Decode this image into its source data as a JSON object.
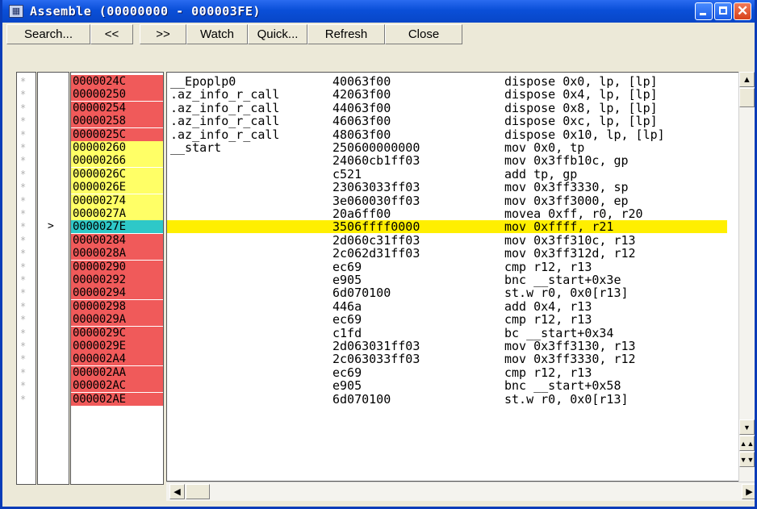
{
  "window": {
    "title": "Assemble (00000000 - 000003FE)"
  },
  "toolbar": [
    {
      "name": "search-button",
      "label": "Search..."
    },
    {
      "name": "prev-button",
      "label": "<<"
    },
    {
      "name": "next-button",
      "label": ">>"
    },
    {
      "name": "watch-button",
      "label": "Watch"
    },
    {
      "name": "quick-button",
      "label": "Quick..."
    },
    {
      "name": "refresh-button",
      "label": "Refresh"
    },
    {
      "name": "close-button",
      "label": "Close"
    }
  ],
  "colors": {
    "red": "#f05a5a",
    "yellow": "#ffff66",
    "cyan": "#2ec8c8",
    "highlight": "#ffef00"
  },
  "rows": [
    {
      "mark": "*",
      "ptr": "",
      "addr": "0000024C",
      "color": "red",
      "label": "__Epoplp0",
      "hex": "40063f00",
      "dis": "dispose 0x0, lp, [lp]",
      "hl": false
    },
    {
      "mark": "*",
      "ptr": "",
      "addr": "00000250",
      "color": "red",
      "label": ".az_info_r_call",
      "hex": "42063f00",
      "dis": "dispose 0x4, lp, [lp]",
      "hl": false
    },
    {
      "mark": "*",
      "ptr": "",
      "addr": "00000254",
      "color": "red",
      "label": ".az_info_r_call",
      "hex": "44063f00",
      "dis": "dispose 0x8, lp, [lp]",
      "hl": false
    },
    {
      "mark": "*",
      "ptr": "",
      "addr": "00000258",
      "color": "red",
      "label": ".az_info_r_call",
      "hex": "46063f00",
      "dis": "dispose 0xc, lp, [lp]",
      "hl": false
    },
    {
      "mark": "*",
      "ptr": "",
      "addr": "0000025C",
      "color": "red",
      "label": ".az_info_r_call",
      "hex": "48063f00",
      "dis": "dispose 0x10, lp, [lp]",
      "hl": false
    },
    {
      "mark": "*",
      "ptr": "",
      "addr": "00000260",
      "color": "yellow",
      "label": "__start",
      "hex": "250600000000",
      "dis": "mov 0x0, tp",
      "hl": false
    },
    {
      "mark": "*",
      "ptr": "",
      "addr": "00000266",
      "color": "yellow",
      "label": "",
      "hex": "24060cb1ff03",
      "dis": "mov 0x3ffb10c, gp",
      "hl": false
    },
    {
      "mark": "*",
      "ptr": "",
      "addr": "0000026C",
      "color": "yellow",
      "label": "",
      "hex": "c521",
      "dis": "add tp, gp",
      "hl": false
    },
    {
      "mark": "*",
      "ptr": "",
      "addr": "0000026E",
      "color": "yellow",
      "label": "",
      "hex": "23063033ff03",
      "dis": "mov 0x3ff3330, sp",
      "hl": false
    },
    {
      "mark": "*",
      "ptr": "",
      "addr": "00000274",
      "color": "yellow",
      "label": "",
      "hex": "3e060030ff03",
      "dis": "mov 0x3ff3000, ep",
      "hl": false
    },
    {
      "mark": "*",
      "ptr": "",
      "addr": "0000027A",
      "color": "yellow",
      "label": "",
      "hex": "20a6ff00",
      "dis": "movea 0xff, r0, r20",
      "hl": false
    },
    {
      "mark": "*",
      "ptr": ">",
      "addr": "0000027E",
      "color": "cyan",
      "label": "",
      "hex": "3506ffff0000",
      "dis": "mov 0xffff, r21",
      "hl": true
    },
    {
      "mark": "*",
      "ptr": "",
      "addr": "00000284",
      "color": "red",
      "label": "",
      "hex": "2d060c31ff03",
      "dis": "mov 0x3ff310c, r13",
      "hl": false
    },
    {
      "mark": "*",
      "ptr": "",
      "addr": "0000028A",
      "color": "red",
      "label": "",
      "hex": "2c062d31ff03",
      "dis": "mov 0x3ff312d, r12",
      "hl": false
    },
    {
      "mark": "*",
      "ptr": "",
      "addr": "00000290",
      "color": "red",
      "label": "",
      "hex": "ec69",
      "dis": "cmp r12, r13",
      "hl": false
    },
    {
      "mark": "*",
      "ptr": "",
      "addr": "00000292",
      "color": "red",
      "label": "",
      "hex": "e905",
      "dis": "bnc __start+0x3e",
      "hl": false
    },
    {
      "mark": "*",
      "ptr": "",
      "addr": "00000294",
      "color": "red",
      "label": "",
      "hex": "6d070100",
      "dis": "st.w r0, 0x0[r13]",
      "hl": false
    },
    {
      "mark": "*",
      "ptr": "",
      "addr": "00000298",
      "color": "red",
      "label": "",
      "hex": "446a",
      "dis": "add 0x4, r13",
      "hl": false
    },
    {
      "mark": "*",
      "ptr": "",
      "addr": "0000029A",
      "color": "red",
      "label": "",
      "hex": "ec69",
      "dis": "cmp r12, r13",
      "hl": false
    },
    {
      "mark": "*",
      "ptr": "",
      "addr": "0000029C",
      "color": "red",
      "label": "",
      "hex": "c1fd",
      "dis": "bc __start+0x34",
      "hl": false
    },
    {
      "mark": "*",
      "ptr": "",
      "addr": "0000029E",
      "color": "red",
      "label": "",
      "hex": "2d063031ff03",
      "dis": "mov 0x3ff3130, r13",
      "hl": false
    },
    {
      "mark": "*",
      "ptr": "",
      "addr": "000002A4",
      "color": "red",
      "label": "",
      "hex": "2c063033ff03",
      "dis": "mov 0x3ff3330, r12",
      "hl": false
    },
    {
      "mark": "*",
      "ptr": "",
      "addr": "000002AA",
      "color": "red",
      "label": "",
      "hex": "ec69",
      "dis": "cmp r12, r13",
      "hl": false
    },
    {
      "mark": "*",
      "ptr": "",
      "addr": "000002AC",
      "color": "red",
      "label": "",
      "hex": "e905",
      "dis": "bnc __start+0x58",
      "hl": false
    },
    {
      "mark": "*",
      "ptr": "",
      "addr": "000002AE",
      "color": "red",
      "label": "",
      "hex": "6d070100",
      "dis": "st.w r0, 0x0[r13]",
      "hl": false
    }
  ]
}
